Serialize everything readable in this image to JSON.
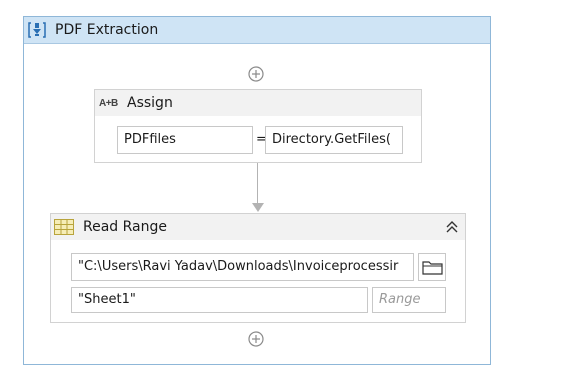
{
  "sequence": {
    "title": "PDF Extraction",
    "icon": "sequence-icon"
  },
  "assign": {
    "title": "Assign",
    "icon_text": "A+B",
    "to_value": "PDFfiles",
    "equals": "=",
    "value": "Directory.GetFiles("
  },
  "read_range": {
    "title": "Read Range",
    "icon": "excel-icon",
    "path_value": "\"C:\\Users\\Ravi Yadav\\Downloads\\Invoiceprocessir",
    "sheet_value": "\"Sheet1\"",
    "range_placeholder": "Range"
  },
  "colors": {
    "sequence_header": "#cfe4f5",
    "sequence_border": "#8fb7d8",
    "activity_header": "#f2f2f2",
    "connector": "#b3b3b3"
  }
}
